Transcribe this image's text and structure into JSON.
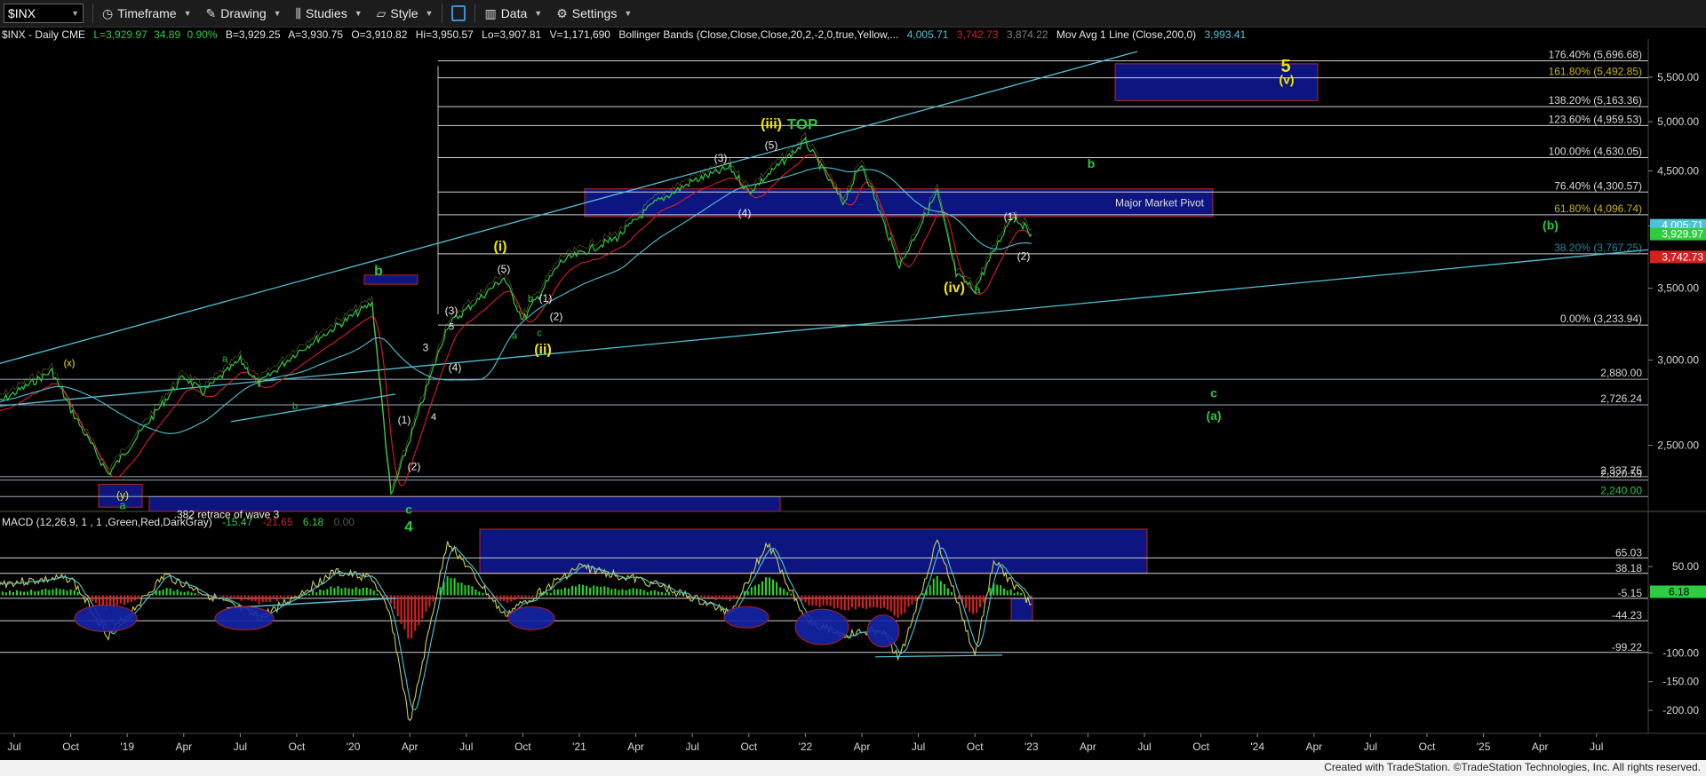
{
  "toolbar": {
    "symbol": "$INX",
    "timeframe": "Timeframe",
    "drawing": "Drawing",
    "studies": "Studies",
    "style": "Style",
    "data": "Data",
    "settings": "Settings"
  },
  "header": {
    "title": "$INX - Daily  CME",
    "L": "L=3,929.97",
    "chg": "34.89",
    "pct": "0.90%",
    "B": "B=3,929.25",
    "A": "A=3,930.75",
    "O": "O=3,910.82",
    "Hi": "Hi=3,950.57",
    "Lo": "Lo=3,907.81",
    "V": "V=1,171,690",
    "bb": "Bollinger Bands (Close,Close,Close,20,2,-2,0,true,Yellow,...",
    "bb_upper": "4,005.71",
    "bb_lower": "3,742.73",
    "bb_mid": "3,874.22",
    "ma": "Mov Avg 1 Line (Close,200,0)",
    "ma_val": "3,993.41"
  },
  "macd_header": {
    "label": "MACD (12,26,9, 1 , 1 ,Green,Red,DarkGray)",
    "v1": "-15.47",
    "v2": "-21.65",
    "v3": "6.18",
    "v4": "0.00"
  },
  "footer": "Created with TradeStation. ©TradeStation Technologies, Inc. All rights reserved.",
  "colors": {
    "price": "#2ecc40",
    "ma": "#4ec3d6",
    "bb_lower": "#d62020",
    "fib_line": "#c8c8c8",
    "box": "#0d1680",
    "wave_yellow": "#f2e600",
    "wave_green": "#27c93f"
  },
  "chart_data": [
    {
      "type": "line",
      "title": "$INX - Daily",
      "x_axis_labels": [
        "Jul",
        "Oct",
        "'19",
        "Apr",
        "Jul",
        "Oct",
        "'20",
        "Apr",
        "Jul",
        "Oct",
        "'21",
        "Apr",
        "Jul",
        "Oct",
        "'22",
        "Apr",
        "Jul",
        "Oct",
        "'23",
        "Apr",
        "Jul",
        "Oct",
        "'24",
        "Apr",
        "Jul",
        "Oct",
        "'25",
        "Apr",
        "Jul"
      ],
      "y_ticks": [
        "5,500.00",
        "5,000.00",
        "4,500.00",
        "4,000.00",
        "3,500.00",
        "3,000.00",
        "2,500.00"
      ],
      "ylim": [
        2170,
        5900
      ],
      "series": [
        {
          "name": "$INX",
          "x": [
            "2018-06",
            "2018-09",
            "2018-10",
            "2018-12",
            "2019-04",
            "2019-05",
            "2019-07",
            "2019-08",
            "2019-10",
            "2020-02",
            "2020-03",
            "2020-06",
            "2020-09",
            "2020-10",
            "2020-12",
            "2021-03",
            "2021-05",
            "2021-07",
            "2021-09",
            "2021-10",
            "2022-01",
            "2022-03",
            "2022-04",
            "2022-06",
            "2022-08",
            "2022-09",
            "2022-10",
            "2022-12",
            "2023-01"
          ],
          "values": [
            2730,
            2930,
            2700,
            2350,
            2900,
            2800,
            3000,
            2850,
            3050,
            3390,
            2240,
            3230,
            3580,
            3270,
            3700,
            3900,
            4200,
            4400,
            4530,
            4300,
            4790,
            4200,
            4570,
            3670,
            4300,
            3600,
            3490,
            4100,
            3930
          ]
        }
      ],
      "fib_levels": [
        {
          "label": "176.40% (5,696.68)",
          "value": 5696.68
        },
        {
          "label": "161.80% (5,492.85)",
          "value": 5492.85
        },
        {
          "label": "138.20% (5,163.36)",
          "value": 5163.36
        },
        {
          "label": "123.60% (4,959.53)",
          "value": 4959.53
        },
        {
          "label": "100.00% (4,630.05)",
          "value": 4630.05
        },
        {
          "label": "76.40% (4,300.57)",
          "value": 4300.57
        },
        {
          "label": "61.80% (4,096.74)",
          "value": 4096.74
        },
        {
          "label": "38.20% (3,767.25)",
          "value": 3767.25
        },
        {
          "label": "0.00% (3,233.94)",
          "value": 3233.94
        },
        {
          "label": "2,880.00",
          "value": 2880
        },
        {
          "label": "2,726.24",
          "value": 2726.24
        },
        {
          "label": "2,337.75",
          "value": 2337.75
        },
        {
          "label": "2,320.59",
          "value": 2320.59
        },
        {
          "label": "2,240.00",
          "value": 2240
        }
      ],
      "price_badges": [
        {
          "text": "4,005.71",
          "value": 4005.71,
          "color": "#4ec3d6"
        },
        {
          "text": "3,929.97",
          "value": 3929.97,
          "color": "#2ecc40"
        },
        {
          "text": "3,742.73",
          "value": 3742.73,
          "color": "#d62020"
        }
      ],
      "annotations": [
        {
          "text": "Major Market Pivot"
        },
        {
          "text": ".382 retrace of wave 3"
        },
        {
          "text": "TOP"
        },
        {
          "text": "5"
        },
        {
          "text": "(v)"
        },
        {
          "text": "(iii)"
        },
        {
          "text": "(iv)"
        },
        {
          "text": "(i)"
        },
        {
          "text": "(ii)"
        },
        {
          "text": "(b)"
        },
        {
          "text": "b"
        },
        {
          "text": "c"
        },
        {
          "text": "(a)"
        },
        {
          "text": "a"
        },
        {
          "text": "(y)"
        },
        {
          "text": "(x)"
        },
        {
          "text": "4"
        },
        {
          "text": "(1)"
        },
        {
          "text": "(2)"
        },
        {
          "text": "(3)"
        },
        {
          "text": "(4)"
        },
        {
          "text": "(5)"
        },
        {
          "text": "3"
        }
      ]
    },
    {
      "type": "line",
      "title": "MACD (12,26,9, 1 , 1 ,Green,Red,DarkGray)",
      "y_ticks": [
        "50.00",
        "-100.00",
        "-150.00",
        "-200.00"
      ],
      "ylim": [
        -240,
        115
      ],
      "levels": [
        {
          "label": "65.03",
          "value": 65.03
        },
        {
          "label": "38.18",
          "value": 38.18
        },
        {
          "label": "-5.15",
          "value": -5.15
        },
        {
          "label": "-44.23",
          "value": -44.23
        },
        {
          "label": "-99.22",
          "value": -99.22
        }
      ],
      "badge": {
        "text": "6.18",
        "value": 6.18
      },
      "series": [
        {
          "x": [
            "2018-06",
            "2018-10",
            "2018-12",
            "2019-03",
            "2019-08",
            "2019-12",
            "2020-02",
            "2020-03",
            "2020-04",
            "2020-06",
            "2020-09",
            "2021-01",
            "2021-05",
            "2021-09",
            "2021-11",
            "2022-01",
            "2022-03",
            "2022-05",
            "2022-06",
            "2022-08",
            "2022-10",
            "2022-11",
            "2022-12",
            "2023-01"
          ],
          "values": [
            20,
            30,
            -70,
            35,
            -40,
            40,
            30,
            -40,
            -225,
            95,
            -35,
            50,
            20,
            -30,
            90,
            -40,
            -70,
            -60,
            -110,
            95,
            -105,
            60,
            20,
            -15
          ]
        }
      ]
    }
  ]
}
